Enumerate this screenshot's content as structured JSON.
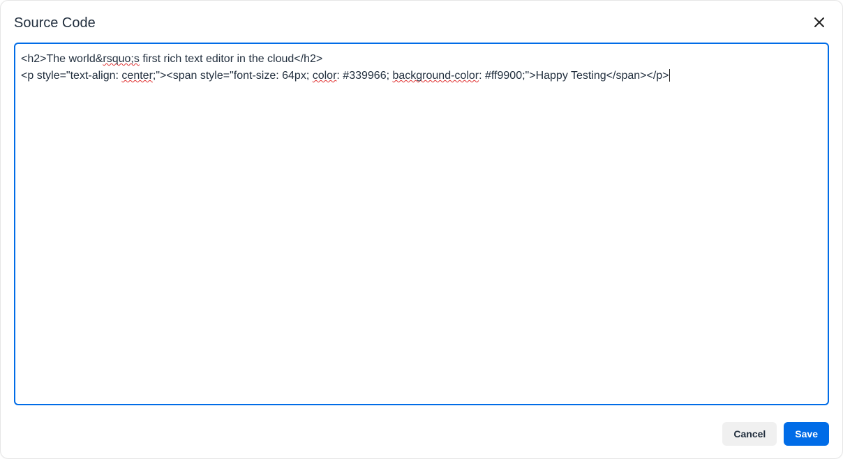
{
  "dialog": {
    "title": "Source Code",
    "close_icon": "close"
  },
  "editor": {
    "code_lines": {
      "line1": {
        "p1": "<h2>The world&",
        "sp1": "rsquo;s",
        "p2": " first rich text editor in the cloud</h2>"
      },
      "line2": {
        "p1": "<p style=\"text-align: ",
        "sp1": "center",
        "p2": ";\"><span style=\"font-size: 64px; ",
        "sp2": "color",
        "p3": ": #339966; ",
        "sp3": "background-color",
        "p4": ": #ff9900;\">Happy Testing</span></p>"
      }
    }
  },
  "footer": {
    "cancel_label": "Cancel",
    "save_label": "Save"
  }
}
